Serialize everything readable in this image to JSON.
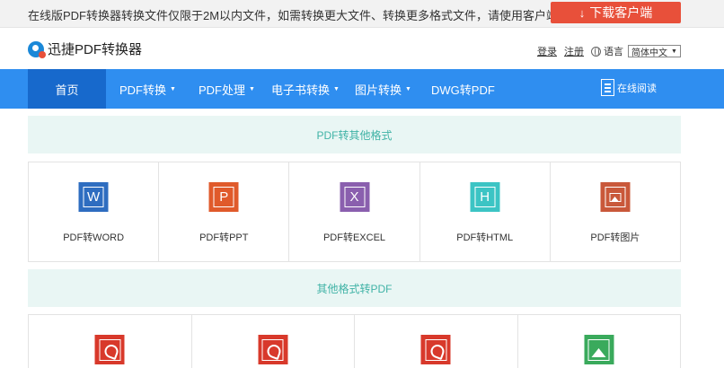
{
  "notice": {
    "text": "在线版PDF转换器转换文件仅限于2M以内文件，如需转换更大文件、转换更多格式文件，请使用客户端。",
    "download_label": "下载客户端",
    "download_icon": "down-arrow-icon",
    "accent": "#e8503a"
  },
  "header": {
    "logo_text": "迅捷PDF转换器",
    "login": "登录",
    "register": "注册",
    "language_label": "语言",
    "language_value": "简体中文"
  },
  "nav": {
    "bg": "#2f8ef0",
    "active_bg": "#1769cc",
    "items": [
      {
        "label": "首页",
        "dropdown": false
      },
      {
        "label": "PDF转换",
        "dropdown": true
      },
      {
        "label": "PDF处理",
        "dropdown": true
      },
      {
        "label": "电子书转换",
        "dropdown": true
      },
      {
        "label": "图片转换",
        "dropdown": true
      },
      {
        "label": "DWG转PDF",
        "dropdown": false
      }
    ],
    "online_read": "在线阅读"
  },
  "section1": {
    "title": "PDF转其他格式",
    "items": [
      {
        "label": "PDF转WORD",
        "glyph": "W",
        "color": "#2e6dc0",
        "icon": "word-icon"
      },
      {
        "label": "PDF转PPT",
        "glyph": "P",
        "color": "#e05a2b",
        "icon": "ppt-icon"
      },
      {
        "label": "PDF转EXCEL",
        "glyph": "X",
        "color": "#8a5fae",
        "icon": "excel-icon"
      },
      {
        "label": "PDF转HTML",
        "glyph": "H",
        "color": "#3cc4c4",
        "icon": "html-icon"
      },
      {
        "label": "PDF转图片",
        "glyph": "",
        "color": "#c9583a",
        "icon": "image-icon"
      }
    ]
  },
  "section2": {
    "title": "其他格式转PDF",
    "items": [
      {
        "color": "#d8392b",
        "icon": "pdf-icon"
      },
      {
        "color": "#d8392b",
        "icon": "pdf-icon"
      },
      {
        "color": "#d8392b",
        "icon": "pdf-icon"
      },
      {
        "color": "#3aaa5c",
        "icon": "image-icon"
      }
    ]
  }
}
